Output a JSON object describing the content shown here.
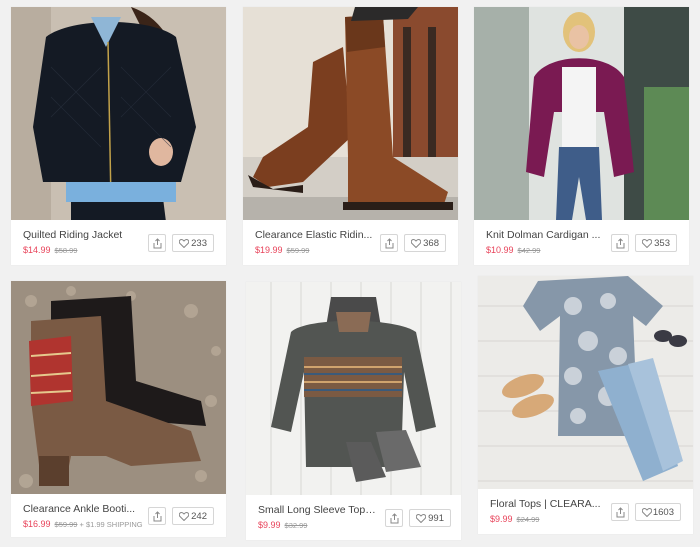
{
  "products": [
    {
      "title": "Quilted Riding Jacket",
      "price": "$14.99",
      "old_price": "$58.99",
      "shipping": "",
      "likes": "233"
    },
    {
      "title": "Clearance Elastic Ridin...",
      "price": "$19.99",
      "old_price": "$59.99",
      "shipping": "",
      "likes": "368"
    },
    {
      "title": "Knit Dolman Cardigan ...",
      "price": "$10.99",
      "old_price": "$42.99",
      "shipping": "",
      "likes": "353"
    },
    {
      "title": "Clearance Ankle Booti...",
      "price": "$16.99",
      "old_price": "$59.99",
      "shipping": "+ $1.99 SHIPPING",
      "likes": "242"
    },
    {
      "title": "Small Long Sleeve Tops...",
      "price": "$9.99",
      "old_price": "$32.99",
      "shipping": "",
      "likes": "991"
    },
    {
      "title": "Floral Tops | CLEARA...",
      "price": "$9.99",
      "old_price": "$24.99",
      "shipping": "",
      "likes": "1603"
    }
  ],
  "icons": {
    "share": "share-icon",
    "like": "heart-icon"
  },
  "colors": {
    "price": "#e8435a",
    "old_price": "#999999",
    "background": "#f1f1f1"
  }
}
